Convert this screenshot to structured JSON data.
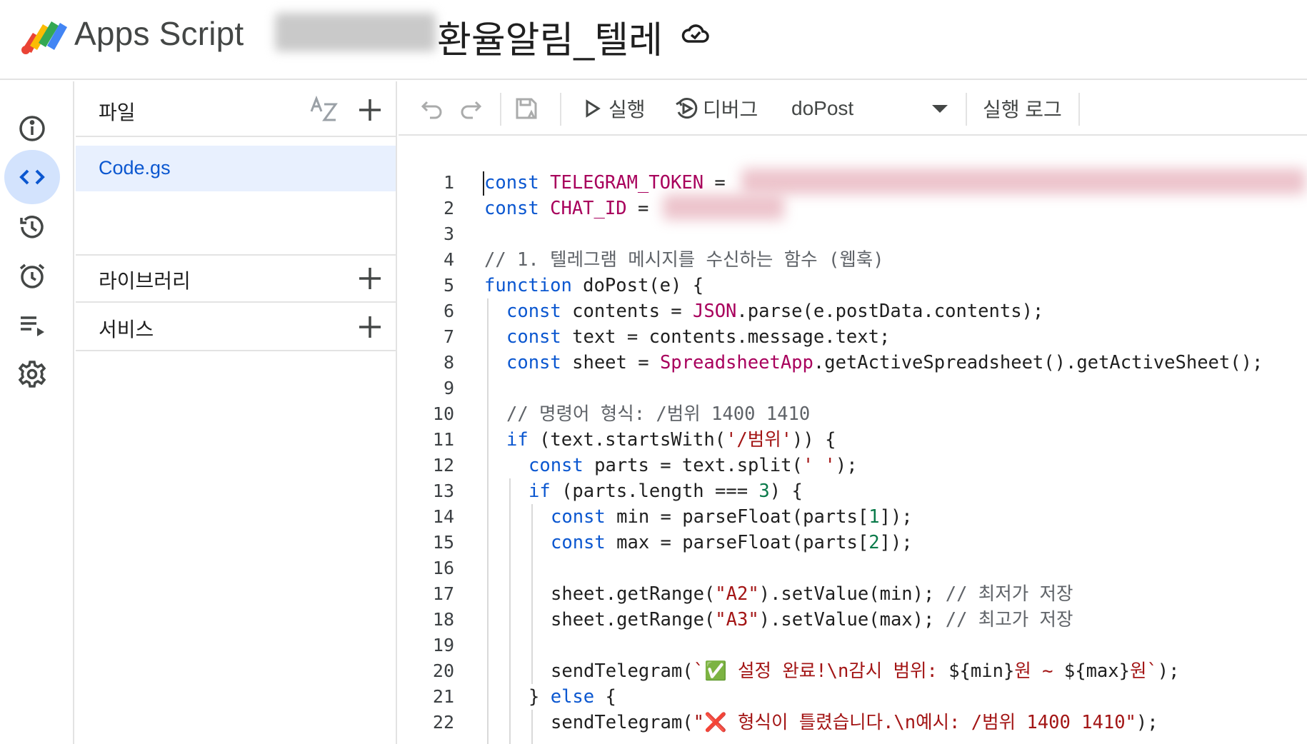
{
  "header": {
    "app_name": "Apps Script",
    "project_title": "환율알림_텔레",
    "logo_icon": "apps-script-logo",
    "cloud_icon": "cloud-saved-icon"
  },
  "rail": {
    "items": [
      {
        "name": "overview",
        "icon": "info-icon"
      },
      {
        "name": "editor",
        "icon": "code-icon",
        "active": true
      },
      {
        "name": "deployments",
        "icon": "history-icon"
      },
      {
        "name": "triggers",
        "icon": "alarm-icon"
      },
      {
        "name": "executions",
        "icon": "executions-icon"
      },
      {
        "name": "settings",
        "icon": "gear-icon"
      }
    ]
  },
  "files_panel": {
    "files_label": "파일",
    "files": [
      {
        "name": "Code.gs"
      }
    ],
    "libraries_label": "라이브러리",
    "services_label": "서비스"
  },
  "toolbar": {
    "run_label": "실행",
    "debug_label": "디버그",
    "function_select": "doPost",
    "execution_log_label": "실행 로그"
  },
  "editor": {
    "line_numbers": [
      "1",
      "2",
      "3",
      "4",
      "5",
      "6",
      "7",
      "8",
      "9",
      "10",
      "11",
      "12",
      "13",
      "14",
      "15",
      "16",
      "17",
      "18",
      "19",
      "20",
      "21",
      "22"
    ],
    "lines": {
      "l1_kw": "const",
      "l1_id": " TELEGRAM_TOKEN",
      "l1_rest": " = ",
      "l2_kw": "const",
      "l2_id": " CHAT_ID",
      "l2_rest": " = ",
      "l4_cm": "// 1. 텔레그램 메시지를 수신하는 함수 (웹훅)",
      "l5_kw": "function",
      "l5_rest": " doPost(e) {",
      "l6_kw": "const",
      "l6_a": " contents = ",
      "l6_id": "JSON",
      "l6_b": ".parse(e.postData.contents);",
      "l7_kw": "const",
      "l7_rest": " text = contents.message.text;",
      "l8_kw": "const",
      "l8_a": " sheet = ",
      "l8_id": "SpreadsheetApp",
      "l8_b": ".getActiveSpreadsheet().getActiveSheet();",
      "l10_cm": "// 명령어 형식: /범위 1400 1410",
      "l11_kw": "if",
      "l11_a": " (text.startsWith(",
      "l11_str": "'/범위'",
      "l11_b": ")) {",
      "l12_kw": "const",
      "l12_a": " parts = text.split(",
      "l12_str": "' '",
      "l12_b": ");",
      "l13_kw": "if",
      "l13_a": " (parts.length === ",
      "l13_num": "3",
      "l13_b": ") {",
      "l14_kw": "const",
      "l14_a": " min = parseFloat(parts[",
      "l14_num": "1",
      "l14_b": "]);",
      "l15_kw": "const",
      "l15_a": " max = parseFloat(parts[",
      "l15_num": "2",
      "l15_b": "]);",
      "l17_a": "sheet.getRange(",
      "l17_str": "\"A2\"",
      "l17_b": ").setValue(min); ",
      "l17_cm": "// 최저가 저장",
      "l18_a": "sheet.getRange(",
      "l18_str": "\"A3\"",
      "l18_b": ").setValue(max); ",
      "l18_cm": "// 최고가 저장",
      "l20_a": "sendTelegram(",
      "l20_str1": "`✅ 설정 완료!\\n감시 범위: ",
      "l20_b": "${min}",
      "l20_str2": "원 ~ ",
      "l20_c": "${max}",
      "l20_str3": "원`",
      "l20_d": ");",
      "l21_a": "} ",
      "l21_kw": "else",
      "l21_b": " {",
      "l22_a": "sendTelegram(",
      "l22_str": "\"❌ 형식이 틀렸습니다.\\n예시: /범위 1400 1410\"",
      "l22_b": ");"
    }
  },
  "colors": {
    "accent": "#0b57d0",
    "active_bg": "#d3e3fd",
    "selected_file_bg": "#e8f0fe",
    "keyword": "#0b57d0",
    "identifier": "#a8005c",
    "string": "#a31515",
    "comment": "#5f6368"
  }
}
